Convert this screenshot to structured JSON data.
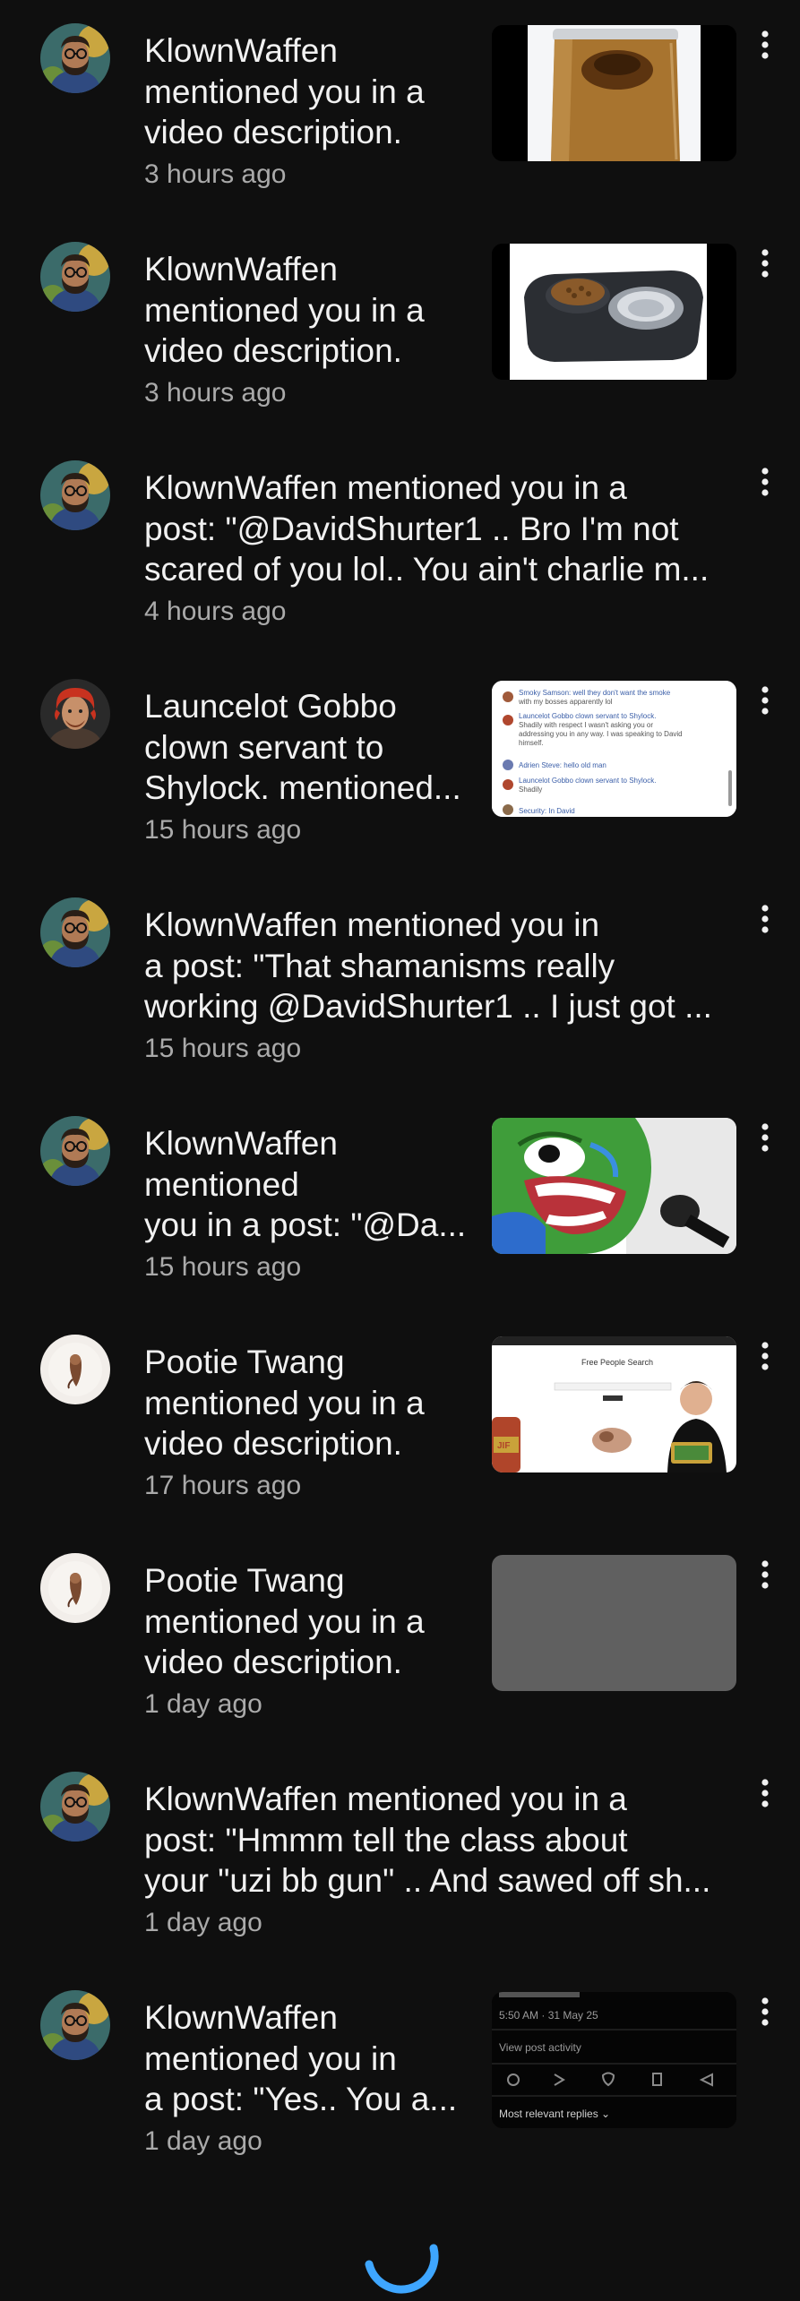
{
  "notifications": [
    {
      "author": "KlownWaffen",
      "lines": [
        "KlownWaffen",
        "mentioned you in a",
        "video description."
      ],
      "time": "3 hours ago",
      "avatar_icon": "bearded-man-avatar-icon",
      "thumbnail": "peanut-butter-jar"
    },
    {
      "author": "KlownWaffen",
      "lines": [
        "KlownWaffen",
        "mentioned you in a",
        "video description."
      ],
      "time": "3 hours ago",
      "avatar_icon": "bearded-man-avatar-icon",
      "thumbnail": "pet-bowls"
    },
    {
      "author": "KlownWaffen",
      "lines": [
        "KlownWaffen mentioned you in a",
        "post: \"@DavidShurter1 .. Bro I'm not",
        "scared of you lol.. You ain't charlie m..."
      ],
      "time": "4 hours ago",
      "avatar_icon": "bearded-man-avatar-icon",
      "thumbnail": null
    },
    {
      "author": "Launcelot Gobbo",
      "lines": [
        "Launcelot Gobbo",
        "clown servant to",
        "Shylock. mentioned..."
      ],
      "time": "15 hours ago",
      "avatar_icon": "red-hair-man-avatar-icon",
      "thumbnail": "comment-screenshot"
    },
    {
      "author": "KlownWaffen",
      "lines": [
        "KlownWaffen mentioned you in",
        "a post: \"That shamanisms really",
        "working @DavidShurter1 .. I just got ..."
      ],
      "time": "15 hours ago",
      "avatar_icon": "bearded-man-avatar-icon",
      "thumbnail": null
    },
    {
      "author": "KlownWaffen",
      "lines": [
        "KlownWaffen",
        "mentioned",
        "you in a post: \"@Da..."
      ],
      "time": "15 hours ago",
      "avatar_icon": "bearded-man-avatar-icon",
      "thumbnail": "crying-frog-microphone"
    },
    {
      "author": "Pootie Twang",
      "lines": [
        "Pootie Twang",
        "mentioned you in a",
        "video description."
      ],
      "time": "17 hours ago",
      "avatar_icon": "small-figure-avatar-icon",
      "thumbnail": "people-search-page"
    },
    {
      "author": "Pootie Twang",
      "lines": [
        "Pootie Twang",
        "mentioned you in a",
        "video description."
      ],
      "time": "1 day ago",
      "avatar_icon": "small-figure-avatar-icon",
      "thumbnail": "gray-placeholder"
    },
    {
      "author": "KlownWaffen",
      "lines": [
        "KlownWaffen mentioned you in a",
        "post: \"Hmmm tell the class about",
        "your \"uzi bb gun\" .. And sawed off sh..."
      ],
      "time": "1 day ago",
      "avatar_icon": "bearded-man-avatar-icon",
      "thumbnail": null
    },
    {
      "author": "KlownWaffen",
      "lines": [
        "KlownWaffen",
        "mentioned you in",
        "a post: \"Yes.. You a..."
      ],
      "time": "1 day ago",
      "avatar_icon": "bearded-man-avatar-icon",
      "thumbnail": "post-activity-screenshot"
    }
  ],
  "thumbnail_text": {
    "people_search_title": "Free People Search",
    "people_search_jar_label": "JIF",
    "post_activity_time": "5:50 AM · 31 May 25",
    "post_activity_link": "View post activity",
    "post_activity_replies": "Most relevant replies ⌄",
    "comment_lines": [
      "Smoky Samson: well they don't want the smoke",
      "with my bosses apparently lol",
      "Launcelot Gobbo clown servant to Shylock.",
      "Shadily with respect I wasn't asking you or",
      "addressing you in any way. I was speaking to David",
      "himself.",
      "Adrien Steve: hello old man",
      "Launcelot Gobbo clown servant to Shylock.",
      "Shadily",
      "Security: In David"
    ]
  },
  "colors": {
    "background": "#0f0f0f",
    "primary_text": "#f1f1f1",
    "secondary_text": "#aaaaaa",
    "spinner": "#3ea6ff"
  },
  "icons": {
    "menu": "more-vert-icon",
    "loading": "loading-spinner-icon"
  }
}
